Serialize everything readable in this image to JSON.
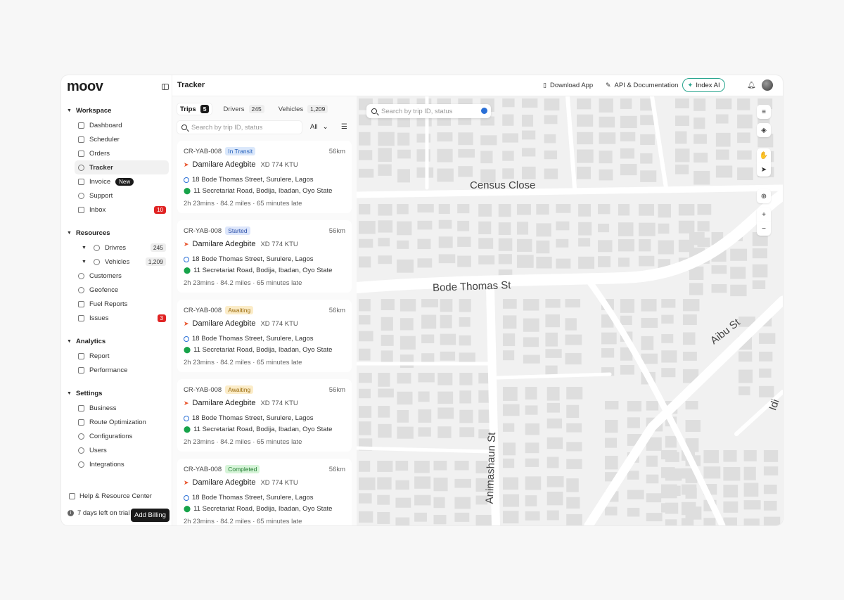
{
  "app": {
    "logo": "moov"
  },
  "sidebar": {
    "sections": [
      {
        "title": "Workspace",
        "items": [
          "Dashboard",
          "Scheduler",
          "Orders",
          "Tracker",
          "Invoice",
          "Support",
          "Inbox"
        ]
      },
      {
        "title": "Resources",
        "items": [
          "Drivres",
          "Vehicles",
          "Customers",
          "Geofence",
          "Fuel Reports",
          "Issues"
        ]
      },
      {
        "title": "Analytics",
        "items": [
          "Report",
          "Performance"
        ]
      },
      {
        "title": "Settings",
        "items": [
          "Business",
          "Route Optimization",
          "Configurations",
          "Users",
          "Integrations"
        ]
      }
    ],
    "invoice_badge": "New",
    "inbox_count": "10",
    "drivers_count": "245",
    "vehicles_count": "1,209",
    "issues_count": "3",
    "help": "Help & Resource Center",
    "trial": "7 days left on trial",
    "billing": "Add Billing"
  },
  "header": {
    "title": "Tracker",
    "download": "Download App",
    "api": "API & Documentation",
    "index_ai": "Index AI"
  },
  "panel": {
    "tabs": [
      {
        "label": "Trips",
        "count": "5"
      },
      {
        "label": "Drivers",
        "count": "245"
      },
      {
        "label": "Vehicles",
        "count": "1,209"
      }
    ],
    "search_placeholder": "Search by trip ID, status",
    "filter_value": "All",
    "trips": [
      {
        "id": "CR-YAB-008",
        "status": "In Transit",
        "distance": "56km",
        "driver": "Damilare Adegbite",
        "plate": "XD 774 KTU",
        "from": "18 Bode Thomas Street, Surulere, Lagos",
        "to": "11 Secretariat Road, Bodija, Ibadan, Oyo State",
        "meta": "2h 23mins  ·  84.2 miles  ·  65 minutes late"
      },
      {
        "id": "CR-YAB-008",
        "status": "Started",
        "distance": "56km",
        "driver": "Damilare Adegbite",
        "plate": "XD 774 KTU",
        "from": "18 Bode Thomas Street, Surulere, Lagos",
        "to": "11 Secretariat Road, Bodija, Ibadan, Oyo State",
        "meta": "2h 23mins  ·  84.2 miles  ·  65 minutes late"
      },
      {
        "id": "CR-YAB-008",
        "status": "Awaiting",
        "distance": "56km",
        "driver": "Damilare Adegbite",
        "plate": "XD 774 KTU",
        "from": "18 Bode Thomas Street, Surulere, Lagos",
        "to": "11 Secretariat Road, Bodija, Ibadan, Oyo State",
        "meta": "2h 23mins  ·  84.2 miles  ·  65 minutes late"
      },
      {
        "id": "CR-YAB-008",
        "status": "Awaiting",
        "distance": "56km",
        "driver": "Damilare Adegbite",
        "plate": "XD 774 KTU",
        "from": "18 Bode Thomas Street, Surulere, Lagos",
        "to": "11 Secretariat Road, Bodija, Ibadan, Oyo State",
        "meta": "2h 23mins  ·  84.2 miles  ·  65 minutes late"
      },
      {
        "id": "CR-YAB-008",
        "status": "Completed",
        "distance": "56km",
        "driver": "Damilare Adegbite",
        "plate": "XD 774 KTU",
        "from": "18 Bode Thomas Street, Surulere, Lagos",
        "to": "11 Secretariat Road, Bodija, Ibadan, Oyo State",
        "meta": "2h 23mins  ·  84.2 miles  ·  65 minutes late"
      }
    ]
  },
  "map": {
    "search_placeholder": "Search by trip ID, status",
    "streets": [
      "Census Close",
      "Bode Thomas St",
      "Aibu St",
      "Animashaun St",
      "Idi"
    ],
    "controls": [
      "≡",
      "◈",
      "✋",
      "➤",
      "⊕",
      "+",
      "−"
    ]
  }
}
